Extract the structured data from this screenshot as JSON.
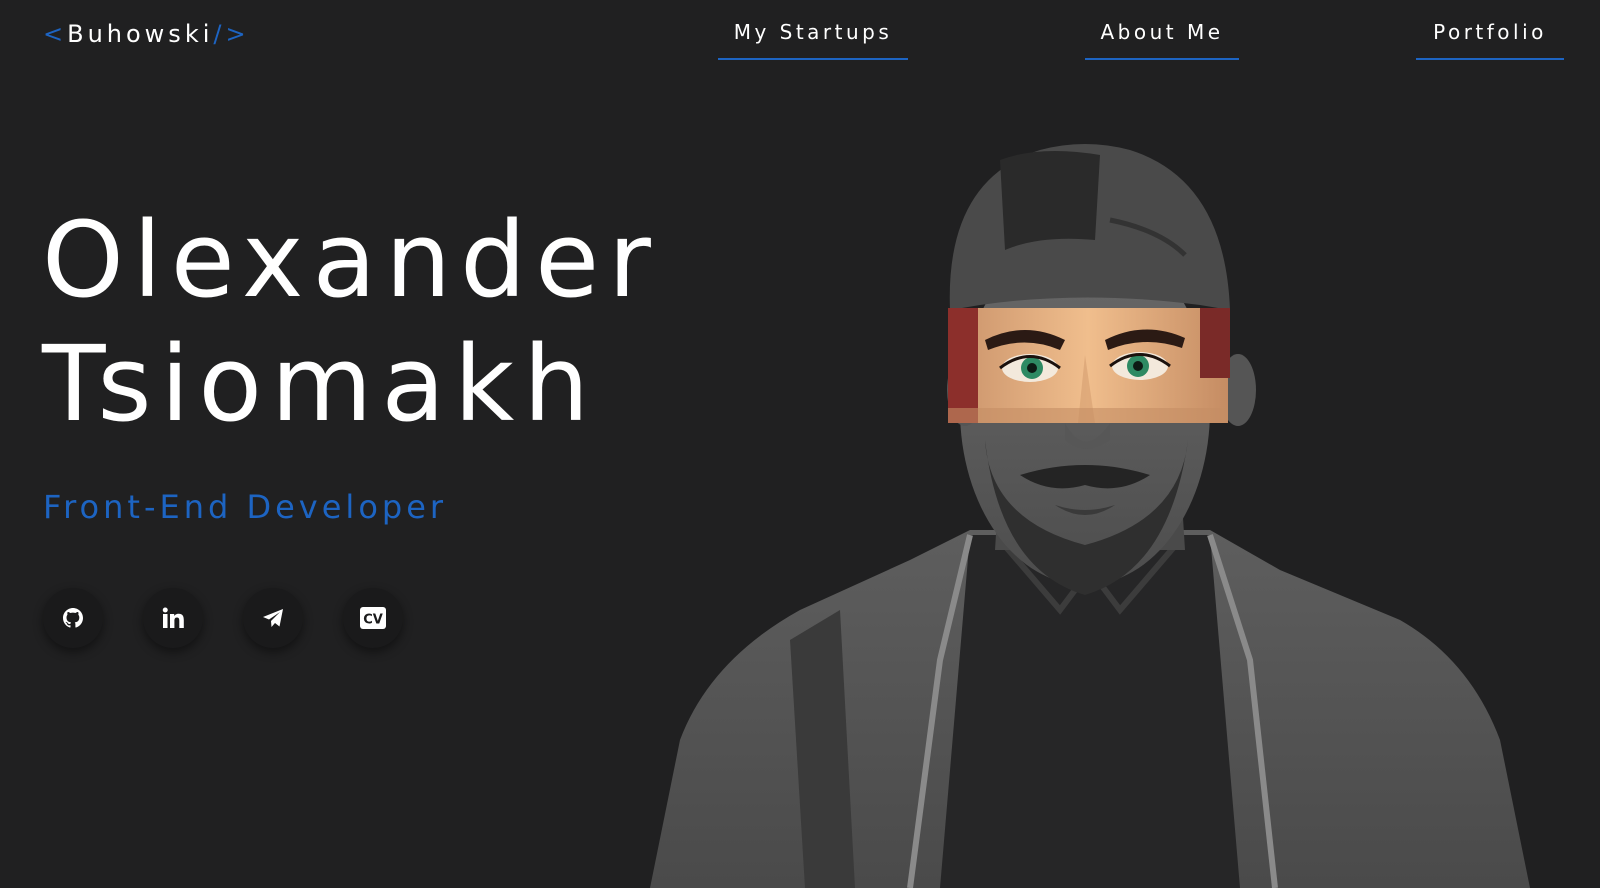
{
  "header": {
    "logo": {
      "open": "<",
      "name": "Buhowski",
      "slash": "/",
      "close": ">"
    },
    "nav": [
      {
        "label": "My Startups"
      },
      {
        "label": "About Me"
      },
      {
        "label": "Portfolio"
      }
    ]
  },
  "hero": {
    "first_name": "Olexander",
    "last_name": "Tsiomakh",
    "role": "Front-End Developer"
  },
  "socials": [
    {
      "icon": "github-icon"
    },
    {
      "icon": "linkedin-icon"
    },
    {
      "icon": "telegram-icon"
    },
    {
      "icon": "cv-icon",
      "text": "CV"
    }
  ],
  "colors": {
    "background": "#202021",
    "accent": "#1d64c2",
    "text": "#ffffff"
  }
}
